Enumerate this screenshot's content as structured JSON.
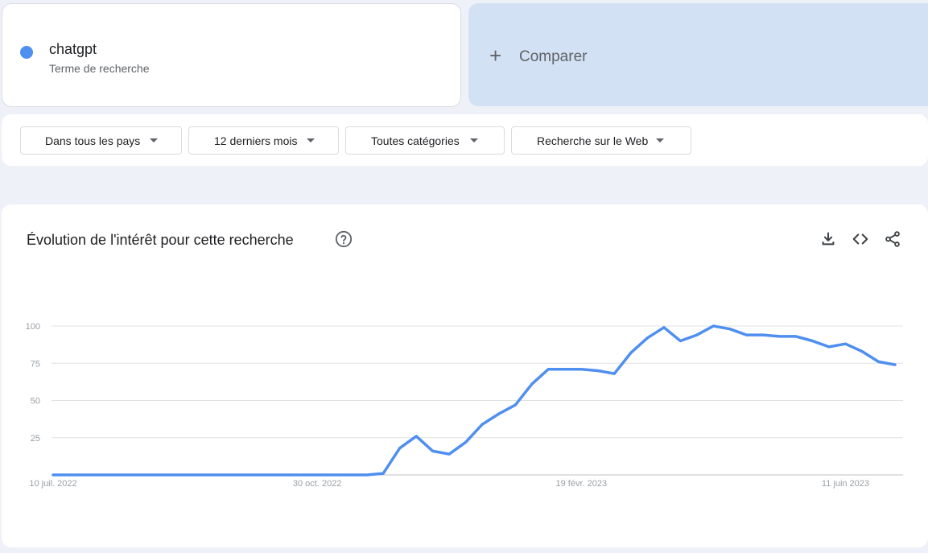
{
  "search_term": {
    "name": "chatgpt",
    "subtitle": "Terme de recherche",
    "color": "#4f8ff0"
  },
  "compare": {
    "label": "Comparer",
    "icon": "plus-icon"
  },
  "filters": [
    {
      "label": "Dans tous les pays"
    },
    {
      "label": "12 derniers mois"
    },
    {
      "label": "Toutes catégories"
    },
    {
      "label": "Recherche sur le Web"
    }
  ],
  "chart_section": {
    "title": "Évolution de l'intérêt pour cette recherche",
    "icons": [
      "help-icon",
      "download-icon",
      "embed-icon",
      "share-icon"
    ]
  },
  "chart_data": {
    "type": "line",
    "ylim": [
      0,
      100
    ],
    "y_ticks": [
      25,
      50,
      75,
      100
    ],
    "x_tick_labels": [
      "10 juil. 2022",
      "30 oct. 2022",
      "19 févr. 2023",
      "11 juin 2023"
    ],
    "grid": true,
    "line_color": "#4f8ff0",
    "series": [
      {
        "values": [
          0,
          0,
          0,
          0,
          0,
          0,
          0,
          0,
          0,
          0,
          0,
          0,
          0,
          0,
          0,
          0,
          0,
          0,
          0,
          0,
          1,
          18,
          26,
          16,
          14,
          22,
          34,
          41,
          47,
          61,
          71,
          71,
          71,
          70,
          68,
          82,
          92,
          99,
          90,
          94,
          100,
          98,
          94,
          94,
          93,
          93,
          90,
          86,
          88,
          83,
          76,
          74
        ]
      }
    ]
  }
}
